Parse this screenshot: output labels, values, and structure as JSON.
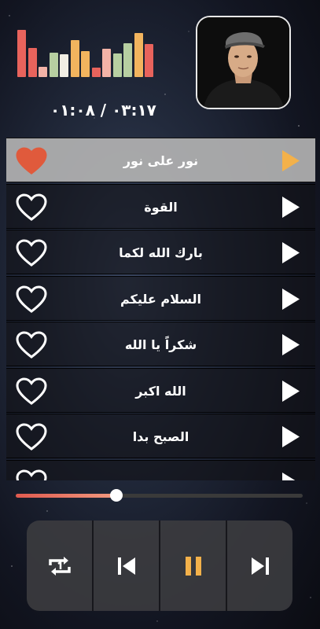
{
  "player": {
    "time_display": "٠٣:١٧ / ٠١:٠٨",
    "progress_fraction": 0.35
  },
  "equalizer": {
    "levels": [
      1.0,
      0.62,
      0.22,
      0.52,
      0.48,
      0.78,
      0.55,
      0.2,
      0.6,
      0.5,
      0.72,
      0.93,
      0.7
    ],
    "colors": [
      "#e8635c",
      "#e8635c",
      "#f3b3a7",
      "#b7cfa1",
      "#f1eee4",
      "#f2b45e",
      "#f2b45e",
      "#e8635c",
      "#f3b3a7",
      "#b7cfa1",
      "#b7cfa1",
      "#f2b45e",
      "#e8635c"
    ]
  },
  "tracks": [
    {
      "title": "نور على نور",
      "liked": true,
      "active": true
    },
    {
      "title": "القوة",
      "liked": false,
      "active": false
    },
    {
      "title": "بارك الله لكما",
      "liked": false,
      "active": false
    },
    {
      "title": "السلام عليكم",
      "liked": false,
      "active": false
    },
    {
      "title": "شكراً يا الله",
      "liked": false,
      "active": false
    },
    {
      "title": "الله اكبر",
      "liked": false,
      "active": false
    },
    {
      "title": "الصبح بدا",
      "liked": false,
      "active": false
    },
    {
      "title": "",
      "liked": false,
      "active": false
    }
  ],
  "controls": {
    "repeat_icon": "repeat-one-icon",
    "prev_icon": "skip-previous-icon",
    "pause_icon": "pause-icon",
    "next_icon": "skip-next-icon"
  },
  "colors": {
    "accent": "#f3b14a",
    "liked": "#e05a3c",
    "progress": "#e05a4f"
  }
}
